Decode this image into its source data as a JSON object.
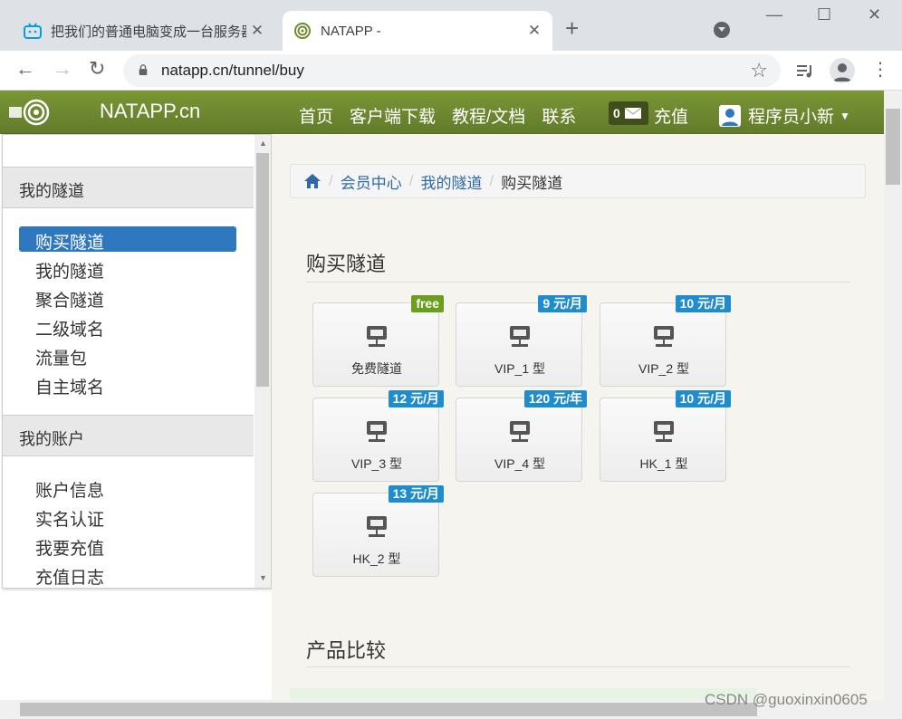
{
  "browser": {
    "tabs": [
      {
        "title": "把我们的普通电脑变成一台服务器",
        "active": false,
        "close": "✕"
      },
      {
        "title": "NATAPP -",
        "active": true,
        "close": "✕"
      }
    ],
    "new_tab": "+",
    "url": "natapp.cn/tunnel/buy"
  },
  "site": {
    "logo": "NATAPP.cn",
    "nav": [
      "首页",
      "客户端下载",
      "教程/文档",
      "联系"
    ],
    "msg_count": "0",
    "recharge": "充值",
    "user": "程序员小新"
  },
  "sidebar": {
    "sections": [
      {
        "title": "我的隧道",
        "items": [
          "购买隧道",
          "我的隧道",
          "聚合隧道",
          "二级域名",
          "流量包",
          "自主域名"
        ]
      },
      {
        "title": "我的账户",
        "items": [
          "账户信息",
          "实名认证",
          "我要充值",
          "充值日志"
        ]
      }
    ]
  },
  "breadcrumb": [
    "会员中心",
    "我的隧道",
    "购买隧道"
  ],
  "page_title": "购买隧道",
  "products": [
    {
      "name": "免费隧道",
      "badge": "free",
      "kind": "free"
    },
    {
      "name": "VIP_1 型",
      "badge": "9 元/月",
      "kind": "price"
    },
    {
      "name": "VIP_2 型",
      "badge": "10 元/月",
      "kind": "price"
    },
    {
      "name": "VIP_3 型",
      "badge": "12 元/月",
      "kind": "price"
    },
    {
      "name": "VIP_4 型",
      "badge": "120 元/年",
      "kind": "price"
    },
    {
      "name": "HK_1 型",
      "badge": "10 元/月",
      "kind": "price"
    },
    {
      "name": "HK_2 型",
      "badge": "13 元/月",
      "kind": "price"
    }
  ],
  "compare_title": "产品比较",
  "watermark": "CSDN @guoxinxin0605",
  "colors": {
    "header": "#6f8a31",
    "accent": "#2f77bf",
    "free": "#6b9e1f",
    "price": "#1f8dcd"
  }
}
